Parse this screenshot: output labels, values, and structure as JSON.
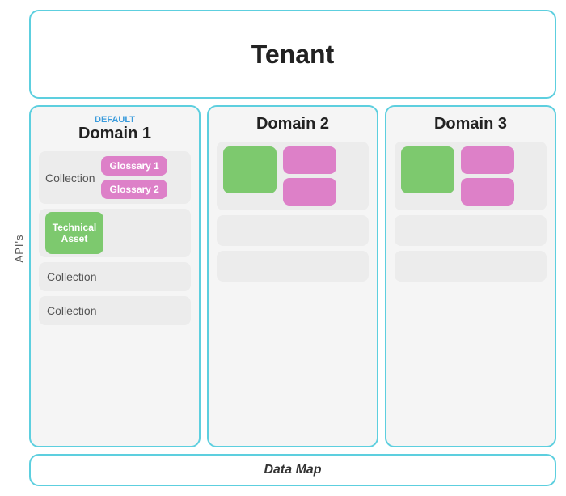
{
  "page": {
    "apis_label": "API's",
    "tenant_label": "Tenant",
    "domain1": {
      "default_label": "DEFAULT",
      "title": "Domain 1",
      "row1_collection": "Collection",
      "row1_glossary1": "Glossary 1",
      "row1_glossary2": "Glossary 2",
      "row2_technical_asset": "Technical Asset",
      "row3_collection": "Collection",
      "row4_collection": "Collection"
    },
    "domain2": {
      "title": "Domain 2"
    },
    "domain3": {
      "title": "Domain 3"
    },
    "datamap_label": "Data Map"
  }
}
